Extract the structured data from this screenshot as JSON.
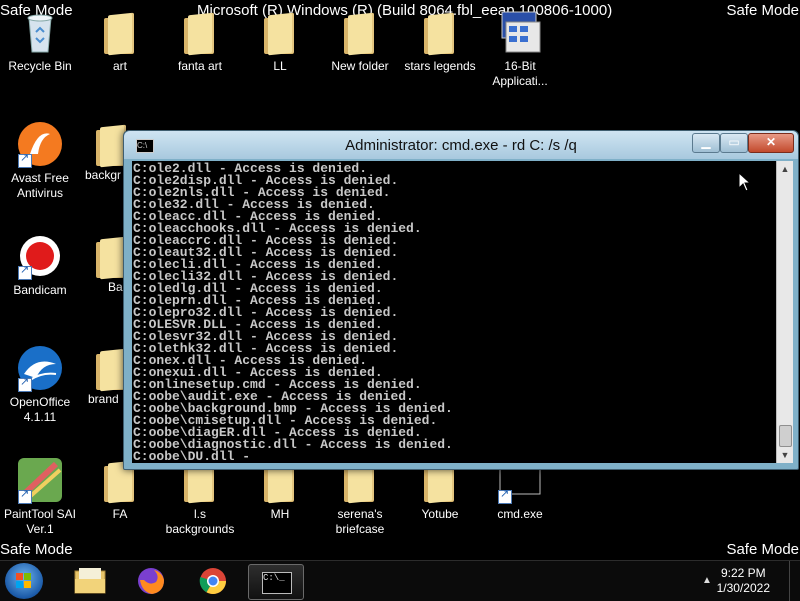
{
  "watermark": {
    "safe_mode": "Safe Mode",
    "build": "Microsoft (R) Windows (R) (Build 8064.fbl_eeap.100806-1000)"
  },
  "desktop_icons": [
    {
      "label": "Recycle Bin",
      "icon": "recycle-bin-icon"
    },
    {
      "label": "art",
      "icon": "folder-icon"
    },
    {
      "label": "fanta art",
      "icon": "folder-icon"
    },
    {
      "label": "LL",
      "icon": "folder-icon"
    },
    {
      "label": "New folder",
      "icon": "folder-icon"
    },
    {
      "label": "stars legends",
      "icon": "folder-icon"
    },
    {
      "label": "16-Bit Applicati...",
      "icon": "app-icon"
    },
    {
      "label": "Avast Free Antivirus",
      "icon": "avast-icon"
    },
    {
      "label": "backgr",
      "icon": "folder-icon"
    },
    {
      "label": "Bandicam",
      "icon": "bandicam-icon"
    },
    {
      "label": "Ba",
      "icon": "folder-icon"
    },
    {
      "label": "OpenOffice 4.1.11",
      "icon": "openoffice-icon"
    },
    {
      "label": "brand",
      "icon": "folder-icon"
    },
    {
      "label": "PaintTool SAI Ver.1",
      "icon": "painttool-sai-icon"
    },
    {
      "label": "FA",
      "icon": "folder-icon"
    },
    {
      "label": "l.s backgrounds",
      "icon": "folder-icon"
    },
    {
      "label": "MH",
      "icon": "folder-icon"
    },
    {
      "label": "serena's briefcase",
      "icon": "folder-icon"
    },
    {
      "label": "Yotube",
      "icon": "folder-icon"
    },
    {
      "label": "cmd.exe",
      "icon": "cmd-icon"
    }
  ],
  "cmd_window": {
    "title": "Administrator: cmd.exe - rd  C: /s /q",
    "title_icon_text": "C:\\",
    "lines": [
      "C:ole2.dll - Access is denied.",
      "C:ole2disp.dll - Access is denied.",
      "C:ole2nls.dll - Access is denied.",
      "C:ole32.dll - Access is denied.",
      "C:oleacc.dll - Access is denied.",
      "C:oleacchooks.dll - Access is denied.",
      "C:oleaccrc.dll - Access is denied.",
      "C:oleaut32.dll - Access is denied.",
      "C:olecli.dll - Access is denied.",
      "C:olecli32.dll - Access is denied.",
      "C:oledlg.dll - Access is denied.",
      "C:oleprn.dll - Access is denied.",
      "C:olepro32.dll - Access is denied.",
      "C:OLESVR.DLL - Access is denied.",
      "C:olesvr32.dll - Access is denied.",
      "C:olethk32.dll - Access is denied.",
      "C:onex.dll - Access is denied.",
      "C:onexui.dll - Access is denied.",
      "C:onlinesetup.cmd - Access is denied.",
      "C:oobe\\audit.exe - Access is denied.",
      "C:oobe\\background.bmp - Access is denied.",
      "C:oobe\\cmisetup.dll - Access is denied.",
      "C:oobe\\diagER.dll - Access is denied.",
      "C:oobe\\diagnostic.dll - Access is denied.",
      "C:oobe\\DU.dll -"
    ],
    "scroll_position": 0.95
  },
  "taskbar": {
    "pinned": [
      {
        "icon": "file-explorer-icon"
      },
      {
        "icon": "firefox-icon"
      },
      {
        "icon": "chrome-icon"
      },
      {
        "icon": "cmd-icon",
        "active": true,
        "text": "C:\\_"
      }
    ],
    "clock": {
      "time": "9:22 PM",
      "date": "1/30/2022"
    },
    "tray_arrow": "▲"
  },
  "colors": {
    "desktop": "#000000",
    "window_frame": "#7fb0c8",
    "console_text": "#c8c8c8",
    "close_button": "#c24a2d"
  }
}
